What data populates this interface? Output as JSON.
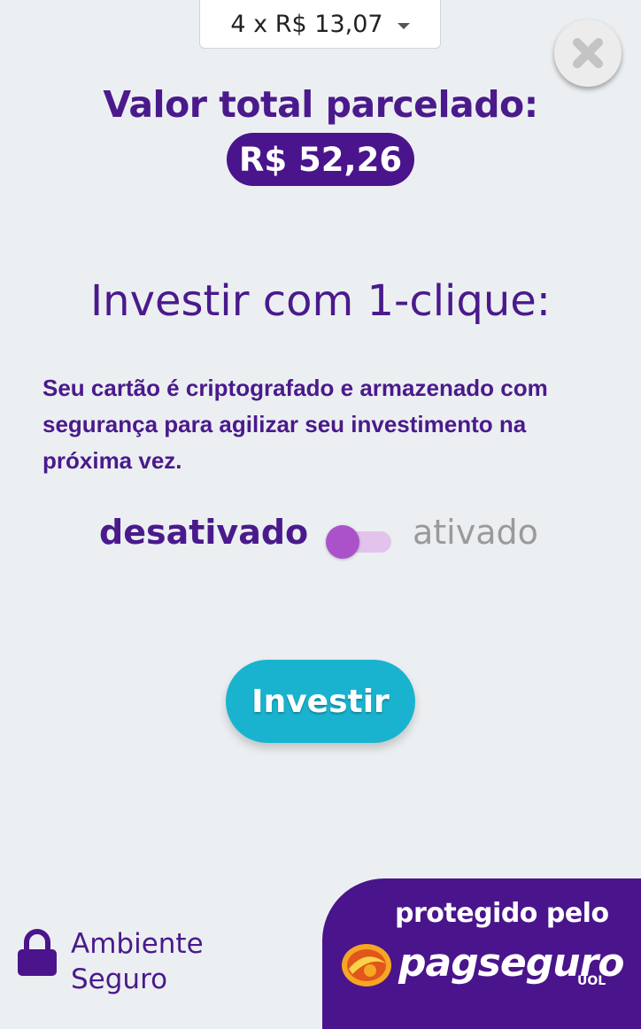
{
  "installment": {
    "selected": "4 x R$ 13,07",
    "icon": "caret-down-icon"
  },
  "close": {
    "icon": "close-icon"
  },
  "total": {
    "label": "Valor total parcelado:",
    "value": "R$ 52,26"
  },
  "one_click": {
    "title": "Investir com 1-clique:",
    "description": "Seu cartão é criptografado e armazenado com segurança para agilizar seu investimento na próxima vez.",
    "toggle_off_label": "desativado",
    "toggle_on_label": "ativado",
    "toggle_enabled": false
  },
  "invest_button": {
    "label": "Investir"
  },
  "secure": {
    "icon": "lock-icon",
    "line1": "Ambiente",
    "line2": "Seguro"
  },
  "badge": {
    "protected_by": "protegido pelo",
    "brand": "pagseguro",
    "sub_brand": "UOL"
  },
  "colors": {
    "background": "#eceff1",
    "primary_purple": "#4a148c",
    "accent_cyan": "#1ab3cf",
    "toggle_knob": "#ab52cb",
    "toggle_track": "#e2c3ec",
    "muted_text": "#9a9a9a"
  }
}
